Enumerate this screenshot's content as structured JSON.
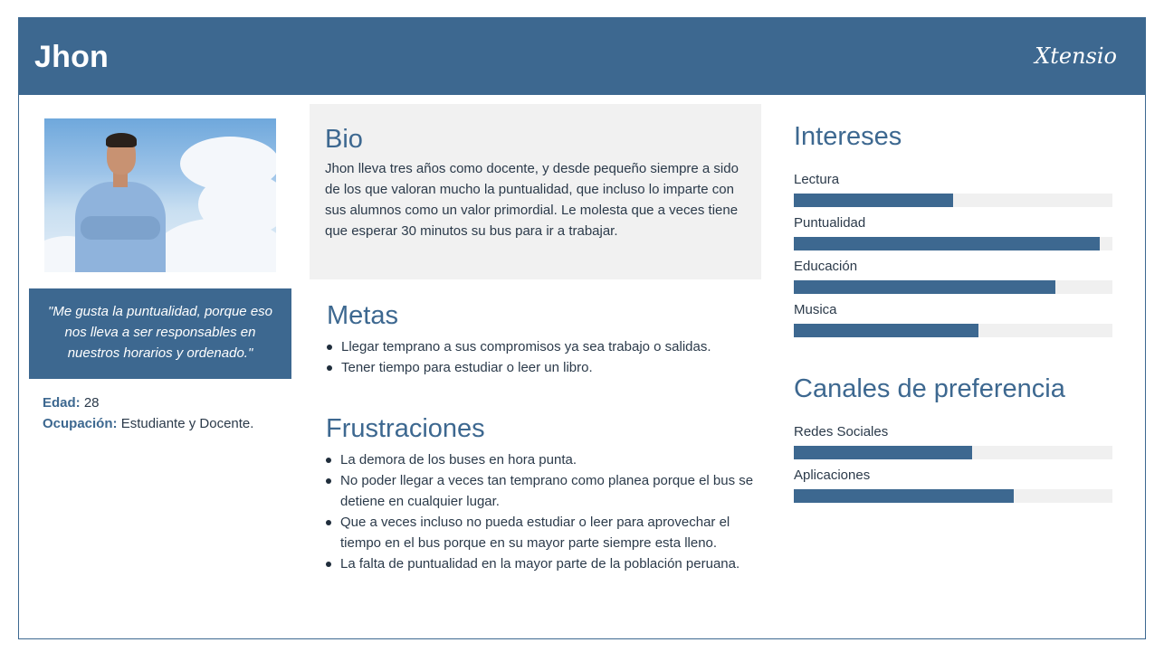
{
  "header": {
    "name": "Jhon",
    "brand": "Xtensio"
  },
  "quote": "\"Me gusta la puntualidad, porque eso nos lleva a ser responsables en nuestros horarios y ordenado.\"",
  "facts": {
    "age_label": "Edad:",
    "age_value": "28",
    "occupation_label": "Ocupación:",
    "occupation_value": "Estudiante y Docente."
  },
  "bio": {
    "title": "Bio",
    "text": "Jhon lleva tres años como docente, y desde pequeño siempre a sido de los que valoran mucho la puntualidad, que incluso lo imparte con sus alumnos como un valor primordial. Le molesta que a veces tiene que esperar 30 minutos su bus para ir a trabajar."
  },
  "metas": {
    "title": "Metas",
    "items": [
      "Llegar temprano a sus compromisos ya sea trabajo o salidas.",
      "Tener tiempo para estudiar o leer un libro."
    ]
  },
  "frustraciones": {
    "title": "Frustraciones",
    "items": [
      "La demora de los buses en hora punta.",
      "No poder llegar a veces tan temprano como planea porque el bus se detiene en cualquier lugar.",
      "Que a veces incluso no pueda estudiar o leer para aprovechar el tiempo en el bus porque en su mayor parte siempre esta lleno.",
      "La falta de puntualidad en la mayor parte de la población peruana."
    ]
  },
  "intereses": {
    "title": "Intereses",
    "items": [
      {
        "label": "Lectura",
        "level": 0.5
      },
      {
        "label": "Puntualidad",
        "level": 0.96
      },
      {
        "label": "Educación",
        "level": 0.82
      },
      {
        "label": "Musica",
        "level": 0.58
      }
    ]
  },
  "canales": {
    "title": "Canales de preferencia",
    "items": [
      {
        "label": "Redes Sociales",
        "level": 0.56
      },
      {
        "label": "Aplicaciones",
        "level": 0.69
      }
    ]
  },
  "colors": {
    "accent": "#3d6890",
    "panel": "#f1f1f1",
    "track": "#f0f0f0"
  }
}
